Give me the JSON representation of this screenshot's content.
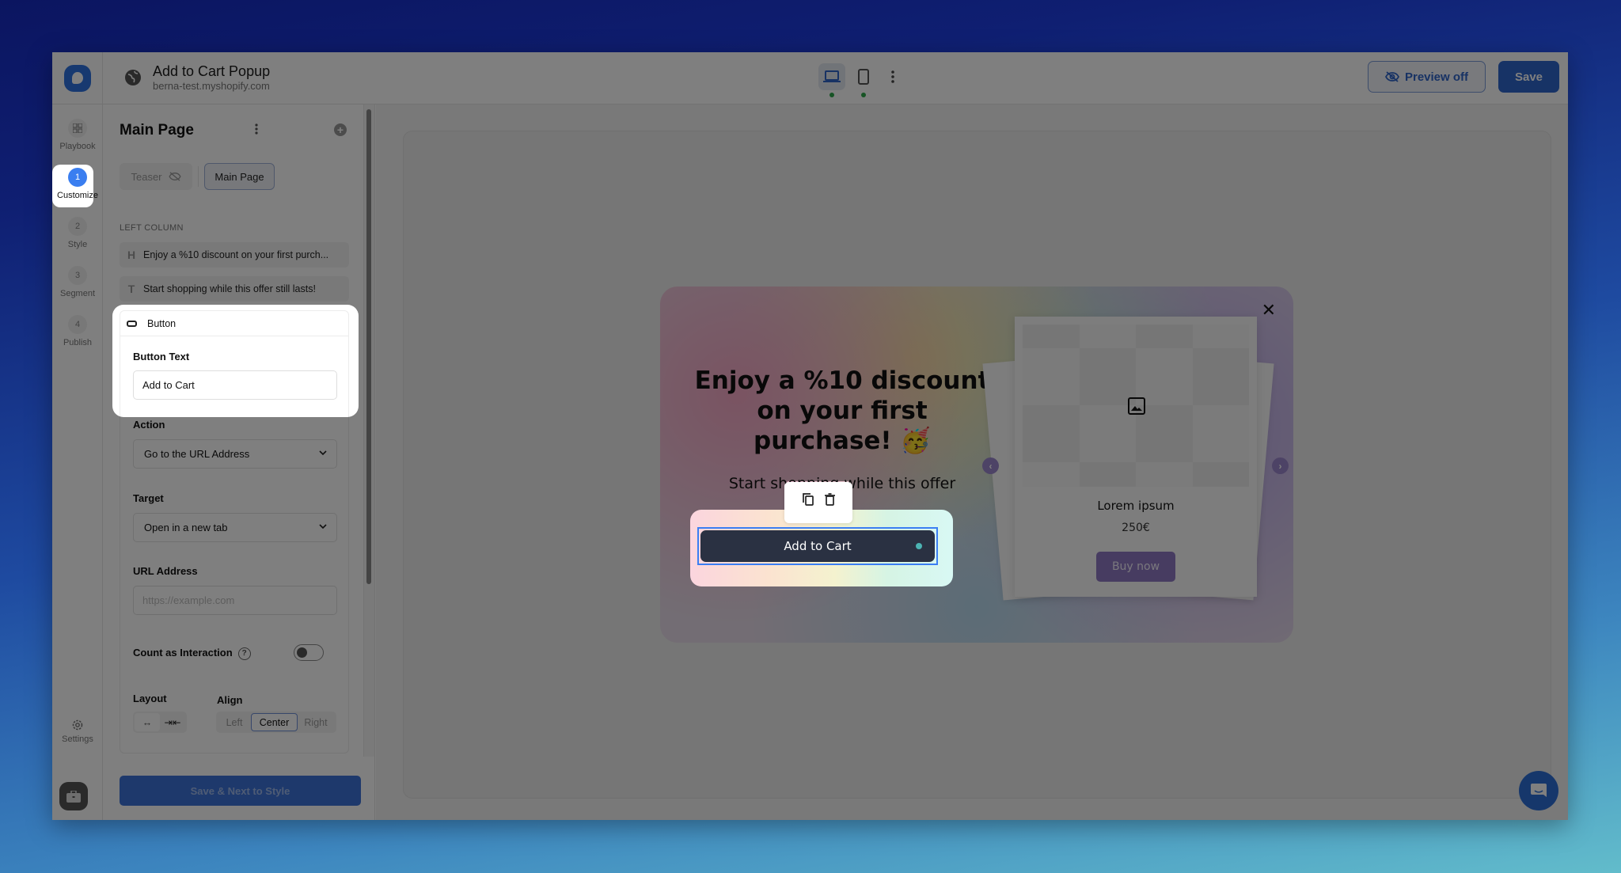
{
  "topbar": {
    "title": "Add to Cart Popup",
    "subtitle": "berna-test.myshopify.com",
    "devices": [
      {
        "name": "desktop",
        "active": true,
        "status_color": "#2ea84a"
      },
      {
        "name": "mobile",
        "active": false,
        "status_color": "#2ea84a"
      }
    ],
    "preview_label": "Preview off",
    "save_label": "Save"
  },
  "rail": {
    "items": [
      {
        "label": "Playbook",
        "icon": "grid-icon"
      },
      {
        "label": "Customize",
        "step": "1",
        "active": true
      },
      {
        "label": "Style",
        "step": "2"
      },
      {
        "label": "Segment",
        "step": "3"
      },
      {
        "label": "Publish",
        "step": "4"
      }
    ],
    "settings_label": "Settings"
  },
  "panel": {
    "title": "Main Page",
    "tabs": [
      {
        "label": "Teaser",
        "hidden": true
      },
      {
        "label": "Main Page",
        "active": true
      }
    ],
    "section_label": "LEFT COLUMN",
    "layers": [
      {
        "type_glyph": "H",
        "label": "Enjoy a %10 discount on your first purch..."
      },
      {
        "type_glyph": "T",
        "label": "Start shopping while this offer still lasts!"
      }
    ],
    "button_card": {
      "header": "Button",
      "button_text_label": "Button Text",
      "button_text_value": "Add to Cart",
      "action_label": "Action",
      "action_value": "Go to the URL Address",
      "target_label": "Target",
      "target_value": "Open in a new tab",
      "url_label": "URL Address",
      "url_placeholder": "https://example.com",
      "url_value": "",
      "count_label": "Count as Interaction",
      "count_enabled": false,
      "layout_label": "Layout",
      "layout_options": [
        "↔",
        "⇥⇤"
      ],
      "layout_selected": 0,
      "align_label": "Align",
      "align_options": [
        "Left",
        "Center",
        "Right"
      ],
      "align_selected": "Center"
    },
    "save_next_label": "Save & Next to Style"
  },
  "popup": {
    "heading": "Enjoy a %10 discount on your first purchase! 🥳",
    "subtext": "Start shopping while this offer",
    "cta_label": "Add to Cart",
    "product": {
      "name": "Lorem ipsum",
      "price": "250€",
      "buy_label": "Buy now"
    },
    "close_glyph": "✕",
    "prev_glyph": "‹",
    "next_glyph": "›"
  },
  "colors": {
    "accent": "#2e66cc",
    "step_active": "#3a7ef0",
    "cta_bg": "#2a3142",
    "buy_bg": "#8e78c2"
  }
}
